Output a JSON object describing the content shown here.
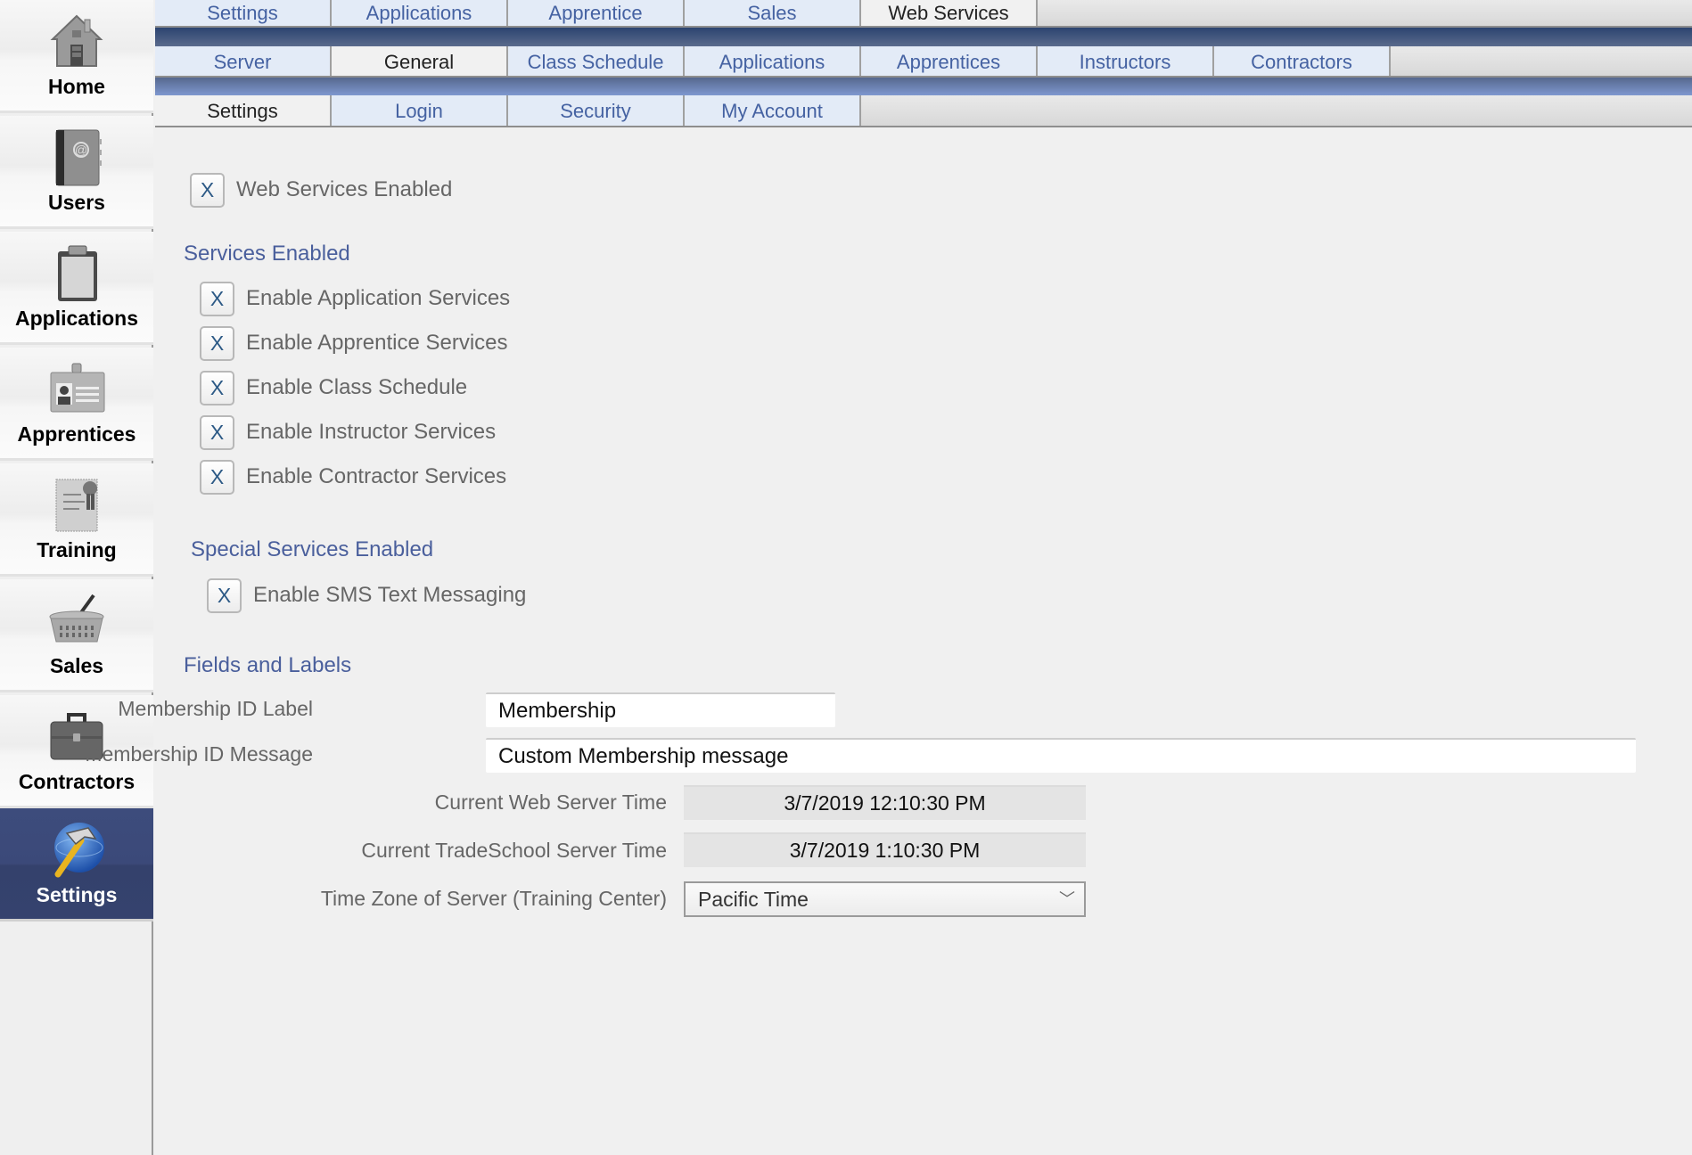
{
  "sidebar": {
    "items": [
      {
        "label": "Home",
        "icon": "home-icon",
        "active": false
      },
      {
        "label": "Users",
        "icon": "address-book-icon",
        "active": false
      },
      {
        "label": "Applications",
        "icon": "clipboard-icon",
        "active": false
      },
      {
        "label": "Apprentices",
        "icon": "id-badge-icon",
        "active": false
      },
      {
        "label": "Training",
        "icon": "certificate-icon",
        "active": false
      },
      {
        "label": "Sales",
        "icon": "basket-icon",
        "active": false
      },
      {
        "label": "Contractors",
        "icon": "briefcase-icon",
        "active": false
      },
      {
        "label": "Settings",
        "icon": "hammer-globe-icon",
        "active": true
      }
    ]
  },
  "tabs": {
    "row1": [
      {
        "label": "Settings",
        "active": false
      },
      {
        "label": "Applications",
        "active": false
      },
      {
        "label": "Apprentice",
        "active": false
      },
      {
        "label": "Sales",
        "active": false
      },
      {
        "label": "Web Services",
        "active": true
      }
    ],
    "row2": [
      {
        "label": "Server",
        "active": false
      },
      {
        "label": "General",
        "active": true
      },
      {
        "label": "Class Schedule",
        "active": false
      },
      {
        "label": "Applications",
        "active": false
      },
      {
        "label": "Apprentices",
        "active": false
      },
      {
        "label": "Instructors",
        "active": false
      },
      {
        "label": "Contractors",
        "active": false
      }
    ],
    "row3": [
      {
        "label": "Settings",
        "active": true
      },
      {
        "label": "Login",
        "active": false
      },
      {
        "label": "Security",
        "active": false
      },
      {
        "label": "My Account",
        "active": false
      }
    ]
  },
  "main": {
    "web_services_enabled": {
      "label": "Web Services Enabled",
      "mark": "X",
      "checked": true
    },
    "services_section": "Services Enabled",
    "services": [
      {
        "label": "Enable Application Services",
        "mark": "X",
        "checked": true
      },
      {
        "label": "Enable Apprentice Services",
        "mark": "X",
        "checked": true
      },
      {
        "label": "Enable Class Schedule",
        "mark": "X",
        "checked": true
      },
      {
        "label": "Enable Instructor Services",
        "mark": "X",
        "checked": true
      },
      {
        "label": "Enable Contractor Services",
        "mark": "X",
        "checked": true
      }
    ],
    "special_section": "Special Services Enabled",
    "special": [
      {
        "label": "Enable SMS Text Messaging",
        "mark": "X",
        "checked": true
      }
    ],
    "fields_section": "Fields and Labels",
    "fields": {
      "membership_label": {
        "label": "Membership ID Label",
        "value": "Membership"
      },
      "membership_message": {
        "label": "Membership ID Message",
        "value": "Custom Membership message"
      },
      "web_server_time": {
        "label": "Current Web Server Time",
        "value": "3/7/2019 12:10:30 PM"
      },
      "tradeschool_time": {
        "label": "Current TradeSchool Server Time",
        "value": "3/7/2019 1:10:30 PM"
      },
      "time_zone": {
        "label": "Time Zone of Server (Training Center)",
        "value": "Pacific Time",
        "chevron": "﹀"
      }
    }
  },
  "colors": {
    "accent": "#4a5f9c",
    "tab_text": "#4562a2",
    "sidebar_active": "#3b4979"
  }
}
